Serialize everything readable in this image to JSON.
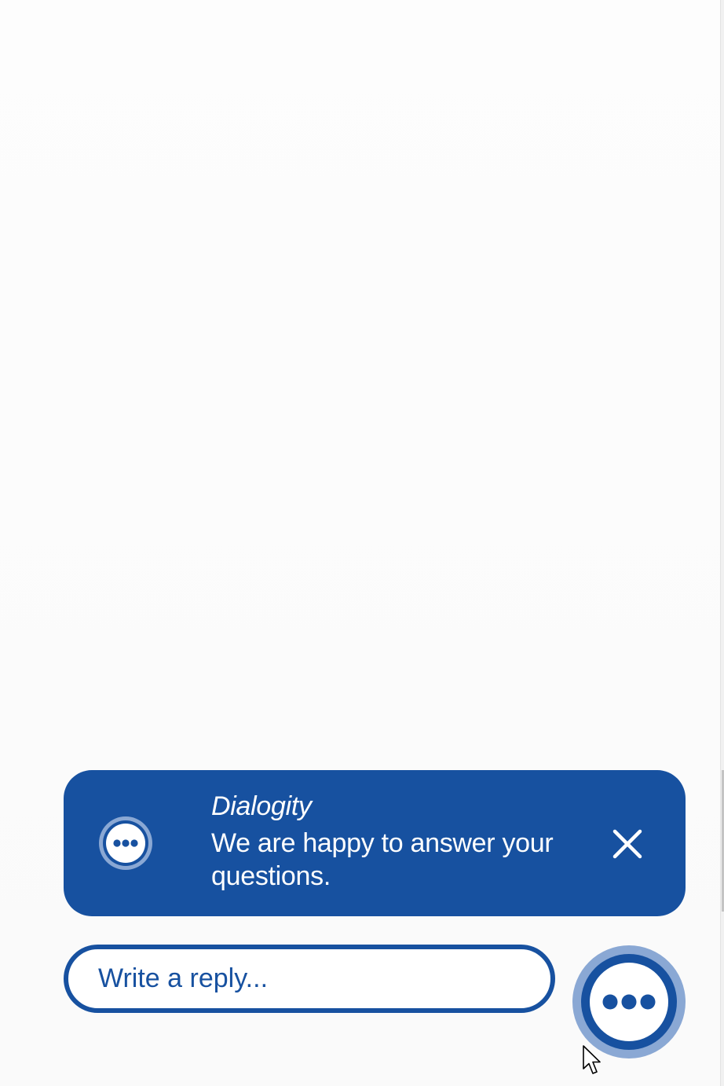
{
  "chat_banner": {
    "title": "Dialogity",
    "message": "We are happy to answer your questions.",
    "avatar_icon": "chat-bubble-ellipsis-icon",
    "close_icon": "close-icon"
  },
  "reply": {
    "placeholder": "Write a reply...",
    "value": ""
  },
  "launcher": {
    "icon": "chat-bubble-ellipsis-icon"
  },
  "colors": {
    "brand": "#1751a0",
    "brand_light": "#8aa8d4",
    "background": "#fdfdfd",
    "text_on_brand": "#ffffff"
  }
}
